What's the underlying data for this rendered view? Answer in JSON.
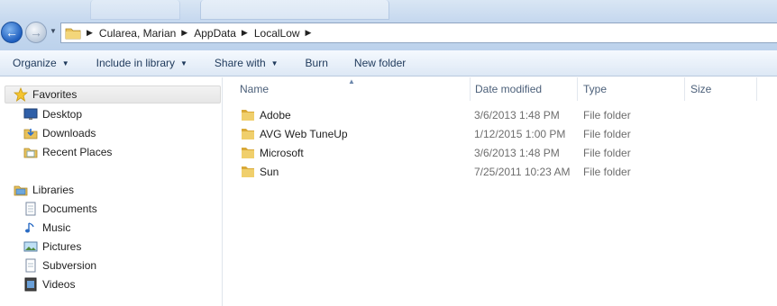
{
  "address": {
    "crumbs": [
      "Cularea, Marian",
      "AppData",
      "LocalLow"
    ]
  },
  "toolbar": {
    "organize": "Organize",
    "include_in_library": "Include in library",
    "share_with": "Share with",
    "burn": "Burn",
    "new_folder": "New folder"
  },
  "navigation": {
    "favorites": {
      "label": "Favorites",
      "items": [
        {
          "label": "Desktop",
          "icon": "desktop-icon"
        },
        {
          "label": "Downloads",
          "icon": "downloads-icon"
        },
        {
          "label": "Recent Places",
          "icon": "recent-places-icon"
        }
      ]
    },
    "libraries": {
      "label": "Libraries",
      "items": [
        {
          "label": "Documents",
          "icon": "documents-icon"
        },
        {
          "label": "Music",
          "icon": "music-icon"
        },
        {
          "label": "Pictures",
          "icon": "pictures-icon"
        },
        {
          "label": "Subversion",
          "icon": "subversion-icon"
        },
        {
          "label": "Videos",
          "icon": "videos-icon"
        }
      ]
    }
  },
  "file_list": {
    "columns": [
      "Name",
      "Date modified",
      "Type",
      "Size"
    ],
    "rows": [
      {
        "name": "Adobe",
        "date": "3/6/2013 1:48 PM",
        "type": "File folder"
      },
      {
        "name": "AVG Web TuneUp",
        "date": "1/12/2015 1:00 PM",
        "type": "File folder"
      },
      {
        "name": "Microsoft",
        "date": "3/6/2013 1:48 PM",
        "type": "File folder"
      },
      {
        "name": "Sun",
        "date": "7/25/2011 10:23 AM",
        "type": "File folder"
      }
    ]
  },
  "colors": {
    "titlebar": "#c7d9ef",
    "toolbar_text": "#1e395b",
    "header_text": "#4c607a",
    "meta_text": "#6d6d6d",
    "folder_yellow": "#e8c15a"
  }
}
